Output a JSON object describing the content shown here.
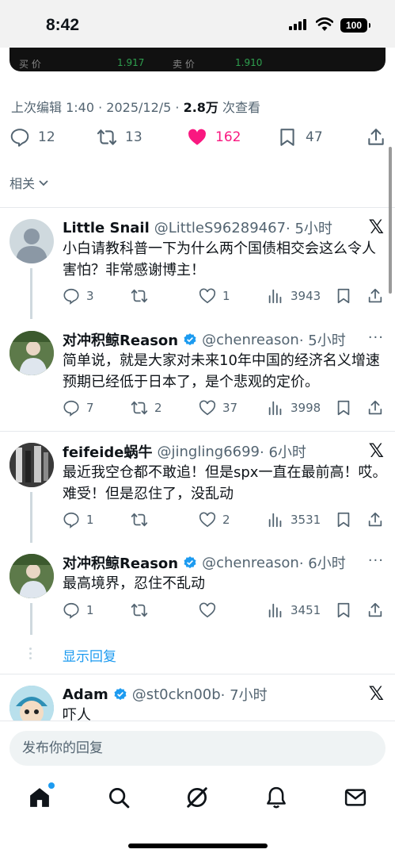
{
  "status": {
    "time": "8:42",
    "battery": "100"
  },
  "quote_card": {
    "labels": [
      "买 价",
      "卖 价"
    ],
    "values": [
      "1.917",
      "1.910"
    ]
  },
  "tweet_meta": {
    "edited": "上次编辑 1:40 · 2025/12/5 · ",
    "views": "2.8万",
    "views_suffix": " 次查看"
  },
  "actions": {
    "replies": "12",
    "reposts": "13",
    "likes": "162",
    "bookmarks": "47"
  },
  "related_label": "相关",
  "replies": [
    {
      "name": "Little Snail",
      "handle": "@LittleS96289467",
      "time": "· 5小时",
      "text": "小白请教科普一下为什么两个国债相交会这么令人害怕？非常感谢博主！",
      "reply_count": "3",
      "repost_count": "",
      "like_count": "1",
      "view_count": "3943"
    },
    {
      "name": "对冲积鲸Reason",
      "handle": "@chenreason",
      "time": "· 5小时",
      "text": "简单说，就是大家对未来10年中国的经济名义增速预期已经低于日本了，是个悲观的定价。",
      "reply_count": "7",
      "repost_count": "2",
      "like_count": "37",
      "view_count": "3998"
    },
    {
      "name": "feifeide蜗牛",
      "handle": "@jingling6699",
      "time": "· 6小时",
      "text": "最近我空仓都不敢追！但是spx一直在最前高！哎。难受！但是忍住了，没乱动",
      "reply_count": "1",
      "repost_count": "",
      "like_count": "2",
      "view_count": "3531"
    },
    {
      "name": "对冲积鲸Reason",
      "handle": "@chenreason",
      "time": "· 6小时",
      "text": "最高境界，忍住不乱动",
      "reply_count": "1",
      "repost_count": "",
      "like_count": "",
      "view_count": "3451"
    },
    {
      "name": "Adam",
      "handle": "@st0ckn00b",
      "time": "· 7小时",
      "text": "吓人"
    }
  ],
  "show_replies": "显示回复",
  "reply_placeholder": "发布你的回复",
  "colors": {
    "accent": "#1d9bf0",
    "like": "#f91880",
    "muted": "#536471"
  }
}
